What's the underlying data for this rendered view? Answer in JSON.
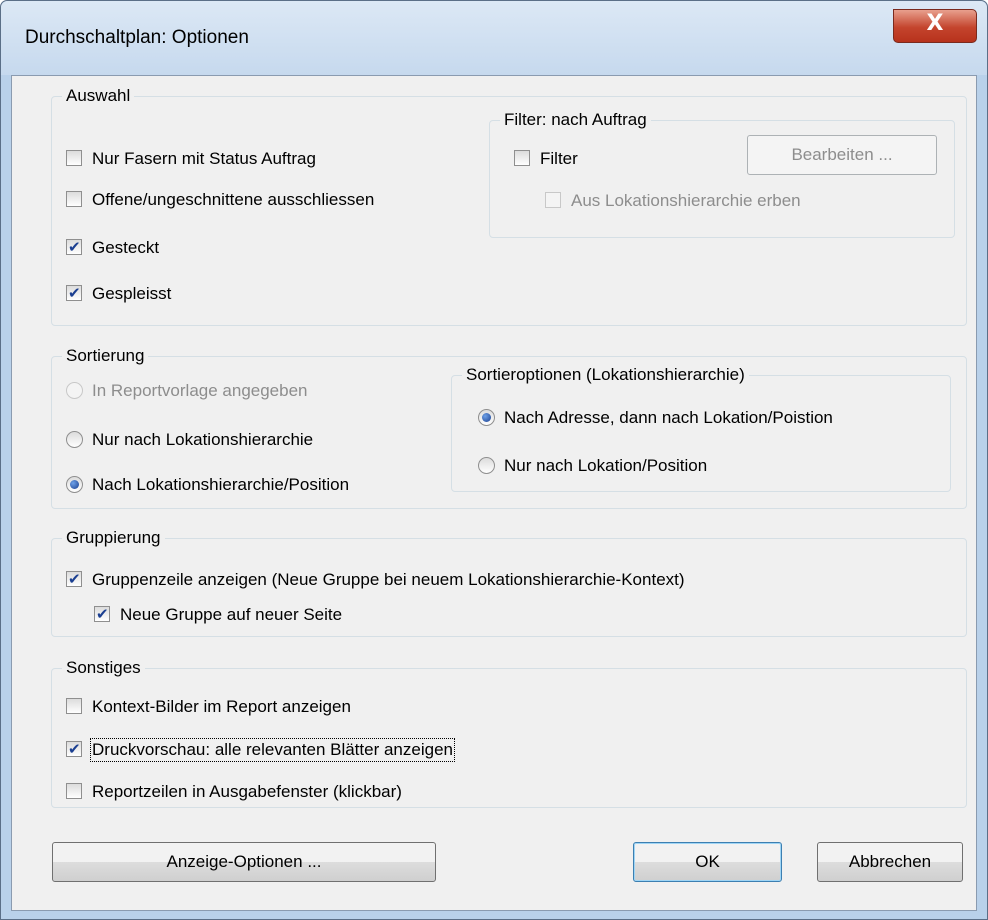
{
  "window": {
    "title": "Durchschaltplan: Optionen",
    "close_symbol": "X"
  },
  "auswahl": {
    "legend": "Auswahl",
    "nur_fasern": {
      "label": "Nur Fasern mit Status Auftrag",
      "checked": false
    },
    "offene": {
      "label": "Offene/ungeschnittene ausschliessen",
      "checked": false
    },
    "gesteckt": {
      "label": "Gesteckt",
      "checked": true
    },
    "gespleisst": {
      "label": "Gespleisst",
      "checked": true
    },
    "filter_group": {
      "legend": "Filter: nach Auftrag",
      "filter": {
        "label": "Filter",
        "checked": false
      },
      "bearbeiten_button": "Bearbeiten ...",
      "erben": {
        "label": "Aus Lokationshierarchie erben",
        "checked": false,
        "enabled": false
      }
    }
  },
  "sortierung": {
    "legend": "Sortierung",
    "options": [
      {
        "label": "In Reportvorlage angegeben",
        "selected": false,
        "enabled": false
      },
      {
        "label": "Nur nach Lokationshierarchie",
        "selected": false,
        "enabled": true
      },
      {
        "label": "Nach Lokationshierarchie/Position",
        "selected": true,
        "enabled": true
      }
    ],
    "sortieroptionen": {
      "legend": "Sortieroptionen (Lokationshierarchie)",
      "options": [
        {
          "label": "Nach Adresse, dann nach Lokation/Poistion",
          "selected": true
        },
        {
          "label": "Nur nach Lokation/Position",
          "selected": false
        }
      ]
    }
  },
  "gruppierung": {
    "legend": "Gruppierung",
    "gruppenzeile": {
      "label": "Gruppenzeile anzeigen (Neue Gruppe bei neuem Lokationshierarchie-Kontext)",
      "checked": true
    },
    "neue_seite": {
      "label": "Neue Gruppe auf neuer Seite",
      "checked": true
    }
  },
  "sonstiges": {
    "legend": "Sonstiges",
    "kontext_bilder": {
      "label": "Kontext-Bilder im Report anzeigen",
      "checked": false
    },
    "druckvorschau": {
      "label": "Druckvorschau: alle relevanten Blätter anzeigen",
      "checked": true
    },
    "reportzeilen": {
      "label": "Reportzeilen in Ausgabefenster (klickbar)",
      "checked": false
    }
  },
  "buttons": {
    "anzeige_optionen": "Anzeige-Optionen ...",
    "ok": "OK",
    "abbrechen": "Abbrechen"
  }
}
